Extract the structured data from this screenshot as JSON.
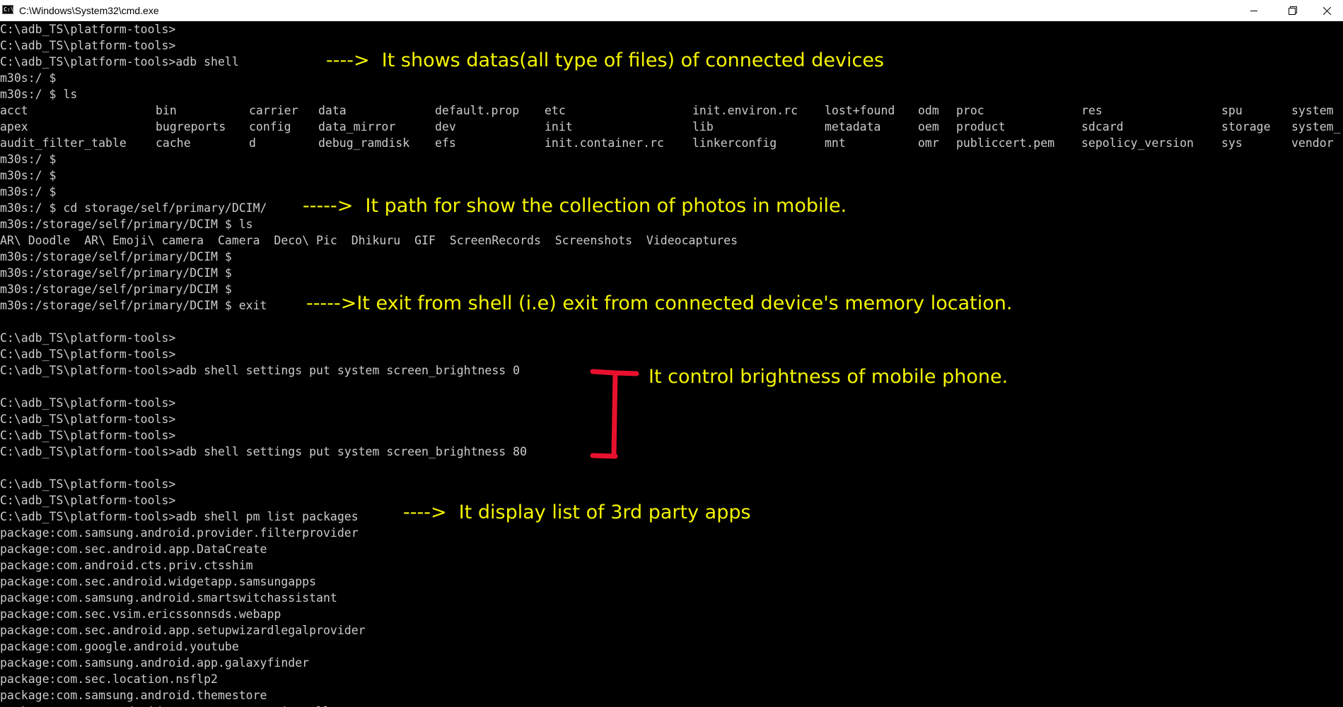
{
  "window": {
    "title": "C:\\Windows\\System32\\cmd.exe",
    "icon": "C:\\"
  },
  "console": {
    "lines_top": [
      "C:\\adb_TS\\platform-tools>",
      "C:\\adb_TS\\platform-tools>",
      "C:\\adb_TS\\platform-tools>adb shell",
      "m30s:/ $",
      "m30s:/ $ ls"
    ],
    "ls_columns": [
      [
        "acct",
        "apex",
        "audit_filter_table"
      ],
      [
        "bin",
        "bugreports",
        "cache"
      ],
      [
        "carrier",
        "config",
        "d"
      ],
      [
        "data",
        "data_mirror",
        "debug_ramdisk"
      ],
      [
        "default.prop",
        "dev",
        "efs"
      ],
      [
        "etc",
        "init",
        "init.container.rc"
      ],
      [
        "init.environ.rc",
        "lib",
        "linkerconfig"
      ],
      [
        "lost+found",
        "metadata",
        "mnt"
      ],
      [
        "odm",
        "oem",
        "omr"
      ],
      [
        "proc",
        "product",
        "publiccert.pem"
      ],
      [
        "res",
        "sdcard",
        "sepolicy_version"
      ],
      [
        "spu",
        "storage",
        "sys"
      ],
      [
        "system",
        "system_",
        "vendor"
      ]
    ],
    "lines_mid": [
      "m30s:/ $",
      "m30s:/ $",
      "m30s:/ $",
      "m30s:/ $ cd storage/self/primary/DCIM/",
      "m30s:/storage/self/primary/DCIM $ ls",
      "AR\\ Doodle  AR\\ Emoji\\ camera  Camera  Deco\\ Pic  Dhikuru  GIF  ScreenRecords  Screenshots  Videocaptures",
      "m30s:/storage/self/primary/DCIM $",
      "m30s:/storage/self/primary/DCIM $",
      "m30s:/storage/self/primary/DCIM $",
      "m30s:/storage/self/primary/DCIM $ exit",
      "",
      "C:\\adb_TS\\platform-tools>",
      "C:\\adb_TS\\platform-tools>",
      "C:\\adb_TS\\platform-tools>adb shell settings put system screen_brightness 0",
      "",
      "C:\\adb_TS\\platform-tools>",
      "C:\\adb_TS\\platform-tools>",
      "C:\\adb_TS\\platform-tools>",
      "C:\\adb_TS\\platform-tools>adb shell settings put system screen_brightness 80",
      "",
      "C:\\adb_TS\\platform-tools>",
      "C:\\adb_TS\\platform-tools>",
      "C:\\adb_TS\\platform-tools>adb shell pm list packages",
      "package:com.samsung.android.provider.filterprovider",
      "package:com.sec.android.app.DataCreate",
      "package:com.android.cts.priv.ctsshim",
      "package:com.sec.android.widgetapp.samsungapps",
      "package:com.samsung.android.smartswitchassistant",
      "package:com.sec.vsim.ericssonnsds.webapp",
      "package:com.sec.android.app.setupwizardlegalprovider",
      "package:com.google.android.youtube",
      "package:com.samsung.android.app.galaxyfinder",
      "package:com.sec.location.nsflp2",
      "package:com.samsung.android.themestore",
      "package:com.sec.android.app.samsungapps.installer"
    ]
  },
  "annotations": {
    "adb_shell": "---->  It shows datas(all type of files) of connected devices",
    "dcim": "----->  It path for show the collection of photos in mobile.",
    "exit": "----->It exit from shell (i.e) exit from connected device's memory location.",
    "brightness": "It control brightness of mobile phone.",
    "packages": "---->  It display list of 3rd party apps"
  },
  "colors": {
    "background": "#000000",
    "text": "#cccccc",
    "annotation": "#f5f500",
    "bracket": "#e8112d"
  }
}
